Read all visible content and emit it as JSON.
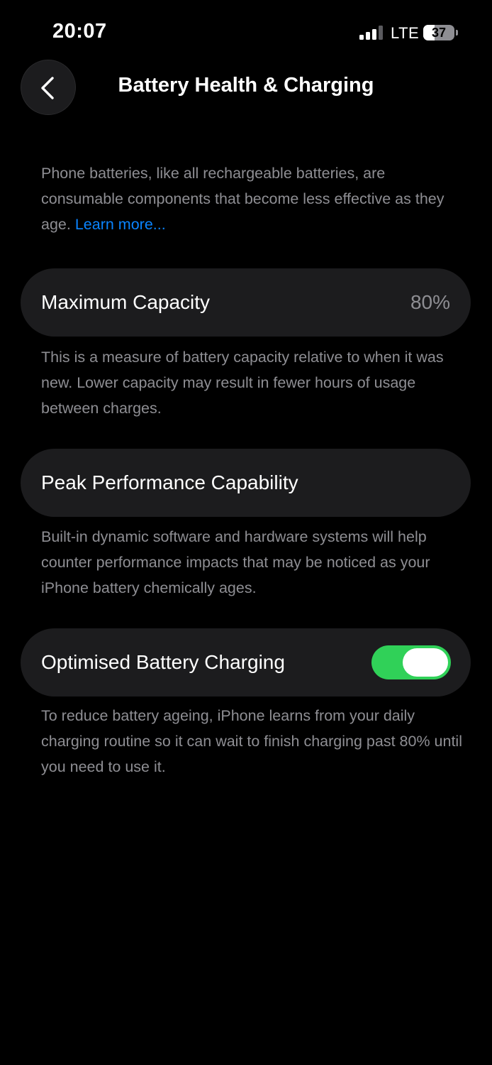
{
  "status_bar": {
    "time": "20:07",
    "network": "LTE",
    "battery_level": "37",
    "battery_fraction": 0.37,
    "signal_bars_active": 3,
    "signal_bars_total": 4
  },
  "nav": {
    "back_icon": "chevron-left-icon",
    "title": "Battery Health & Charging"
  },
  "intro": {
    "text": "Phone batteries, like all rechargeable batteries, are consumable components that become less effective as they age. ",
    "link_text": "Learn more..."
  },
  "maximum_capacity": {
    "label": "Maximum Capacity",
    "value": "80%",
    "description": "This is a measure of battery capacity relative to when it was new. Lower capacity may result in fewer hours of usage between charges."
  },
  "peak_performance": {
    "label": "Peak Performance Capability",
    "description": "Built-in dynamic software and hardware systems will help counter performance impacts that may be noticed as your iPhone battery chemically ages."
  },
  "optimised_charging": {
    "label": "Optimised Battery Charging",
    "enabled": true,
    "description": "To reduce battery ageing, iPhone learns from your daily charging routine so it can wait to finish charging past 80% until you need to use it."
  },
  "colors": {
    "background": "#000000",
    "card": "#1c1c1e",
    "secondary_text": "#8e8e93",
    "link": "#0a84ff",
    "toggle_on": "#30d158"
  }
}
